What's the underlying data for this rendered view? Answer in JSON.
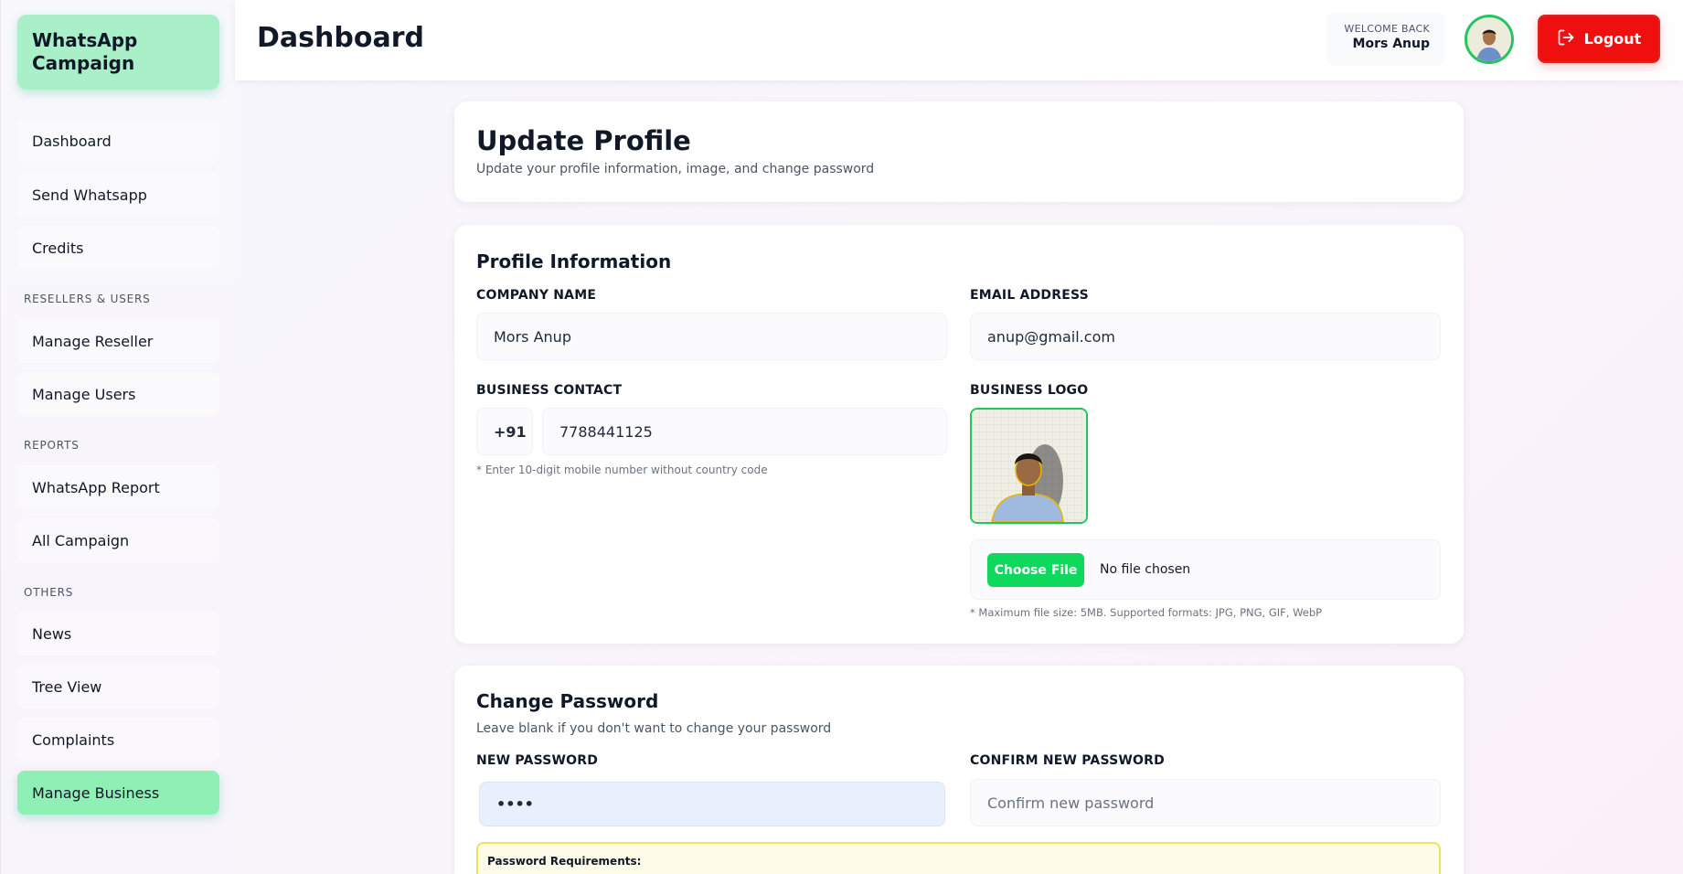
{
  "brand": {
    "title": "WhatsApp Campaign"
  },
  "sidebar": {
    "items_main": [
      {
        "label": "Dashboard"
      },
      {
        "label": "Send Whatsapp"
      },
      {
        "label": "Credits"
      }
    ],
    "sections": [
      {
        "label": "RESELLERS & USERS",
        "items": [
          {
            "label": "Manage Reseller"
          },
          {
            "label": "Manage Users"
          }
        ]
      },
      {
        "label": "REPORTS",
        "items": [
          {
            "label": "WhatsApp Report"
          },
          {
            "label": "All Campaign"
          }
        ]
      },
      {
        "label": "OTHERS",
        "items": [
          {
            "label": "News"
          },
          {
            "label": "Tree View"
          },
          {
            "label": "Complaints"
          },
          {
            "label": "Manage Business"
          }
        ]
      }
    ],
    "active": "Manage Business"
  },
  "header": {
    "title": "Dashboard",
    "welcome_label": "WELCOME BACK",
    "user_name": "Mors Anup",
    "logout_label": "Logout"
  },
  "update_profile": {
    "title": "Update Profile",
    "subtitle": "Update your profile information, image, and change password"
  },
  "profile_info": {
    "title": "Profile Information",
    "company_label": "COMPANY NAME",
    "company_value": "Mors Anup",
    "email_label": "EMAIL ADDRESS",
    "email_value": "anup@gmail.com",
    "contact_label": "BUSINESS CONTACT",
    "country_code": "+91",
    "phone_value": "7788441125",
    "phone_hint": "* Enter 10-digit mobile number without country code",
    "logo_label": "BUSINESS LOGO",
    "choose_file_label": "Choose File",
    "no_file_label": "No file chosen",
    "file_hint": "* Maximum file size: 5MB. Supported formats: JPG, PNG, GIF, WebP"
  },
  "change_password": {
    "title": "Change Password",
    "subtitle": "Leave blank if you don't want to change your password",
    "new_label": "NEW PASSWORD",
    "new_value": "••••",
    "confirm_label": "CONFIRM NEW PASSWORD",
    "confirm_placeholder": "Confirm new password",
    "requirements_title": "Password Requirements:"
  },
  "colors": {
    "accent_green": "#22c55e",
    "active_nav": "#8ef0b4",
    "logout_red": "#ef0f0f"
  },
  "icons": {
    "logout": "logout-icon"
  }
}
